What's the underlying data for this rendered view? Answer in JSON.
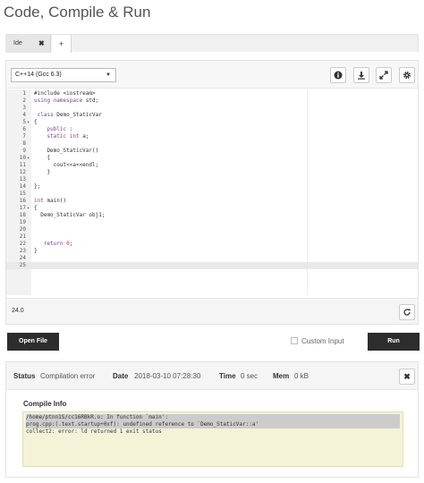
{
  "page": {
    "title": "Code, Compile & Run"
  },
  "tabs": [
    {
      "label": "Ide",
      "close": "✖"
    },
    {
      "label": "+"
    }
  ],
  "editor": {
    "language": "C++14 (Gcc 6.3)",
    "tool_icons": [
      "info-icon",
      "download-icon",
      "expand-icon",
      "gear-icon"
    ],
    "lines": [
      {
        "n": "1",
        "fold": "",
        "code": "#include <iostream>"
      },
      {
        "n": "2",
        "fold": "",
        "code": "using namespace std;"
      },
      {
        "n": "3",
        "fold": "",
        "code": ""
      },
      {
        "n": "4",
        "fold": "",
        "code": " class Demo_StaticVar"
      },
      {
        "n": "5",
        "fold": "▾",
        "code": "{"
      },
      {
        "n": "6",
        "fold": "",
        "code": "    public :"
      },
      {
        "n": "7",
        "fold": "",
        "code": "    static int a;"
      },
      {
        "n": "8",
        "fold": "",
        "code": ""
      },
      {
        "n": "9",
        "fold": "",
        "code": "    Demo_StaticVar()"
      },
      {
        "n": "10",
        "fold": "▾",
        "code": "    {"
      },
      {
        "n": "11",
        "fold": "",
        "code": "      cout<<a<<endl;"
      },
      {
        "n": "12",
        "fold": "",
        "code": "    }"
      },
      {
        "n": "13",
        "fold": "",
        "code": ""
      },
      {
        "n": "14",
        "fold": "",
        "code": "};"
      },
      {
        "n": "15",
        "fold": "",
        "code": ""
      },
      {
        "n": "16",
        "fold": "",
        "code": "int main()"
      },
      {
        "n": "17",
        "fold": "▾",
        "code": "{"
      },
      {
        "n": "18",
        "fold": "",
        "code": "  Demo_StaticVar obj1;"
      },
      {
        "n": "19",
        "fold": "",
        "code": ""
      },
      {
        "n": "20",
        "fold": "",
        "code": ""
      },
      {
        "n": "21",
        "fold": "",
        "code": ""
      },
      {
        "n": "22",
        "fold": "",
        "code": "   return 0;"
      },
      {
        "n": "23",
        "fold": "",
        "code": "}"
      },
      {
        "n": "24",
        "fold": "",
        "code": ""
      },
      {
        "n": "25",
        "fold": "",
        "code": ""
      }
    ],
    "status": "24.0"
  },
  "actions": {
    "open_file": "Open File",
    "custom_input": "Custom Input",
    "run": "Run"
  },
  "result": {
    "status_label": "Status",
    "status_value": "Compilation error",
    "date_label": "Date",
    "date_value": "2018-03-10 07:28:30",
    "time_label": "Time",
    "time_value": "0 sec",
    "mem_label": "Mem",
    "mem_value": "0 kB",
    "close": "✖",
    "compile_title": "Compile Info",
    "compile_lines": [
      "/home/ptnn1S/cc16RBkR.o: In function `main':",
      "prog.cpp:(.text.startup+0xf): undefined reference to `Demo_StaticVar::a'",
      "collect2: error: ld returned 1 exit status"
    ]
  },
  "colors": {
    "dark_button": "#2d2d2d",
    "compile_bg": "#f4f3d7",
    "keyword": "#7a3e9d",
    "number": "#c0392b"
  }
}
